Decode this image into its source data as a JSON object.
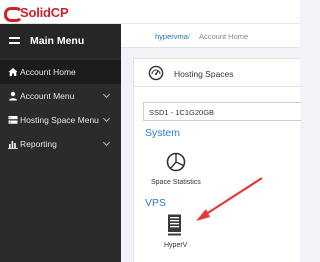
{
  "logo": {
    "text": "SolidCP"
  },
  "sidebar": {
    "header": "Main Menu",
    "items": [
      {
        "label": "Account Home",
        "icon": "home-icon",
        "active": true
      },
      {
        "label": "Account Menu",
        "icon": "user-icon",
        "has_submenu": true
      },
      {
        "label": "Hosting Space Menu",
        "icon": "server-icon",
        "has_submenu": true
      },
      {
        "label": "Reporting",
        "icon": "bar-chart-icon",
        "has_submenu": true
      }
    ]
  },
  "breadcrumb": {
    "link": "hypervma",
    "separator": "/",
    "current": "Account Home"
  },
  "panel": {
    "title": "Hosting Spaces",
    "space_select": "SSD1 - 1C1G20GB",
    "sections": [
      {
        "title": "System",
        "tiles": [
          {
            "label": "Space Statistics",
            "icon": "pie-chart-icon"
          }
        ]
      },
      {
        "title": "VPS",
        "tiles": [
          {
            "label": "HyperV",
            "icon": "server-tower-icon"
          }
        ]
      }
    ]
  },
  "annotation": {
    "color": "#e8373c"
  },
  "colors": {
    "brand": "#c9242b",
    "link": "#1f6eb5",
    "section": "#2a7fd0",
    "sidebar": "#2b2b2b"
  }
}
